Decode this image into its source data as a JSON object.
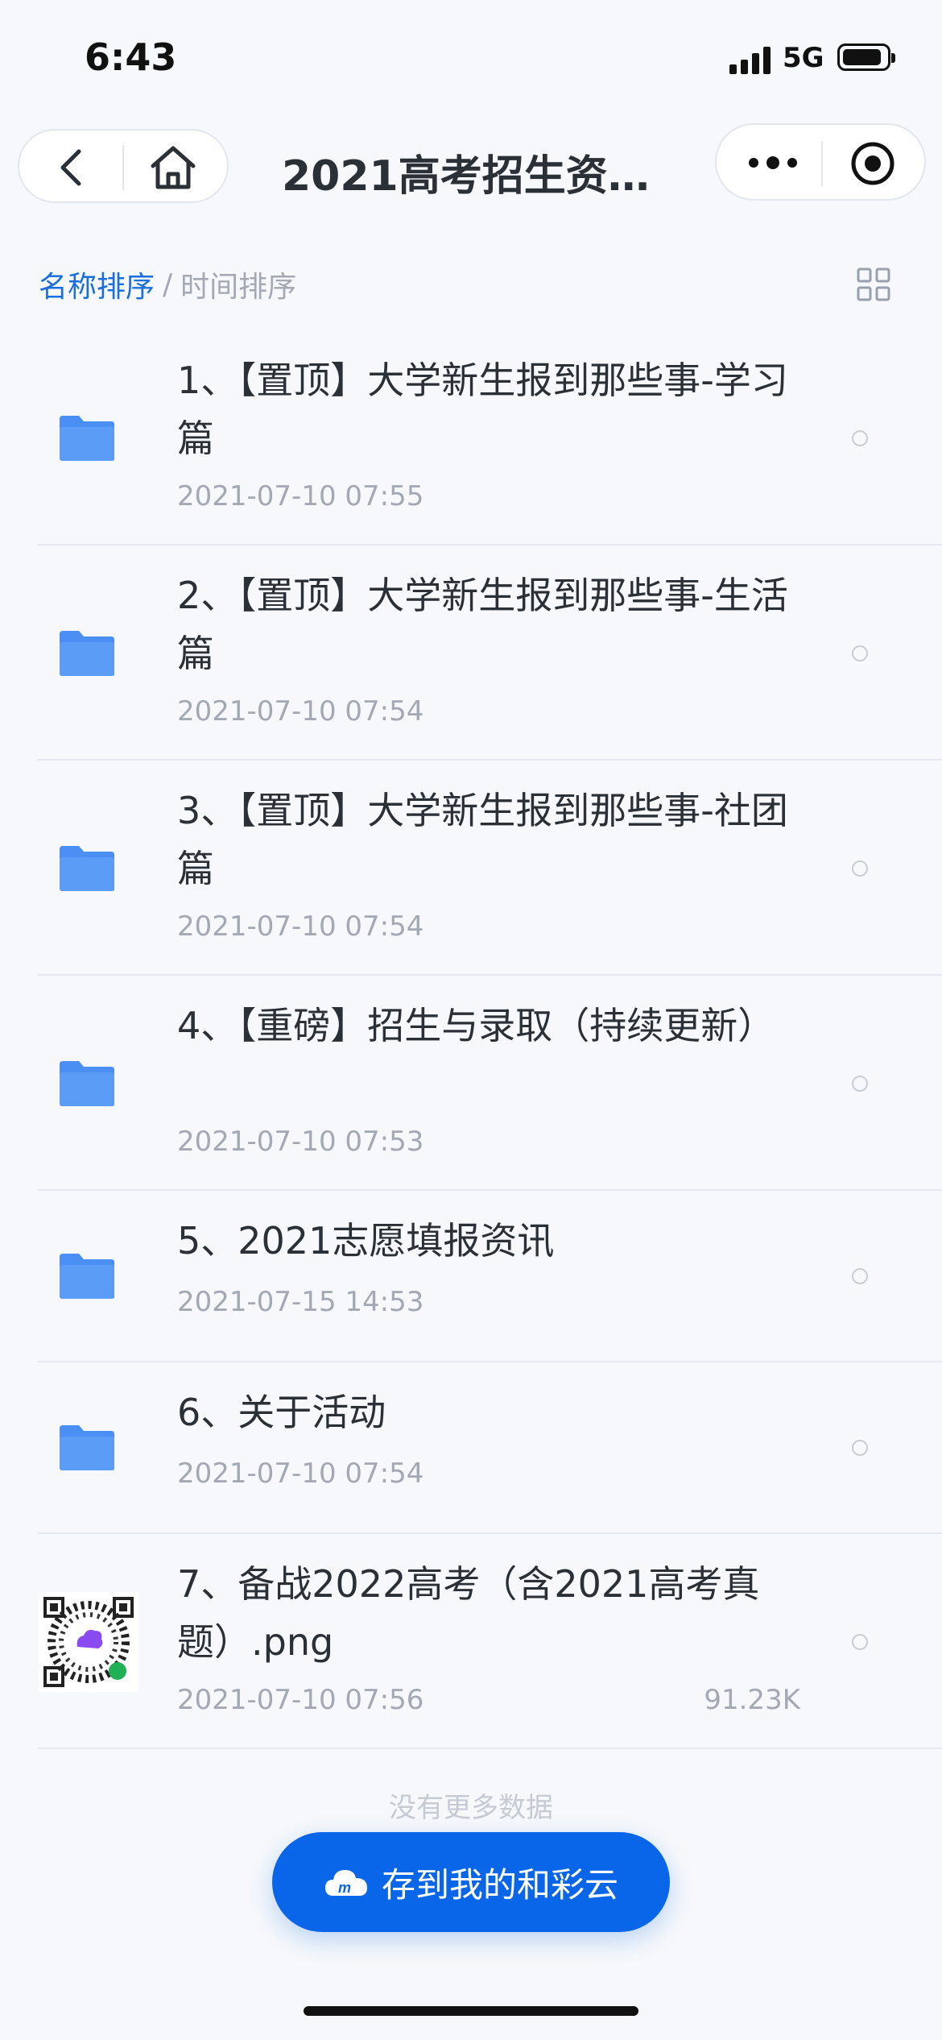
{
  "status_bar": {
    "time": "6:43",
    "network": "5G",
    "battery_level": 0.9
  },
  "nav": {
    "title": "2021高考招生资…",
    "back_icon": "chevron-left-icon",
    "home_icon": "home-icon",
    "more_icon": "more-dots-icon",
    "close_icon": "target-icon"
  },
  "sort": {
    "by_name": "名称排序",
    "separator": "/",
    "by_time": "时间排序"
  },
  "files": [
    {
      "name": "1、【置顶】大学新生报到那些事-学习篇",
      "date": "2021-07-10 07:55",
      "type": "folder",
      "size": ""
    },
    {
      "name": "2、【置顶】大学新生报到那些事-生活篇",
      "date": "2021-07-10 07:54",
      "type": "folder",
      "size": ""
    },
    {
      "name": "3、【置顶】大学新生报到那些事-社团篇",
      "date": "2021-07-10 07:54",
      "type": "folder",
      "size": ""
    },
    {
      "name": "4、【重磅】招生与录取（持续更新）",
      "date": "2021-07-10 07:53",
      "type": "folder",
      "size": ""
    },
    {
      "name": "5、2021志愿填报资讯",
      "date": "2021-07-15 14:53",
      "type": "folder",
      "size": ""
    },
    {
      "name": "6、关于活动",
      "date": "2021-07-10 07:54",
      "type": "folder",
      "size": ""
    },
    {
      "name": "7、备战2022高考（含2021高考真题）.png",
      "date": "2021-07-10 07:56",
      "type": "image",
      "size": "91.23K"
    }
  ],
  "footer": {
    "no_more": "没有更多数据",
    "save_button": "存到我的和彩云"
  },
  "colors": {
    "accent": "#0a66e8",
    "folder": "#4b8ff5",
    "muted_text": "#a3a8b2"
  }
}
